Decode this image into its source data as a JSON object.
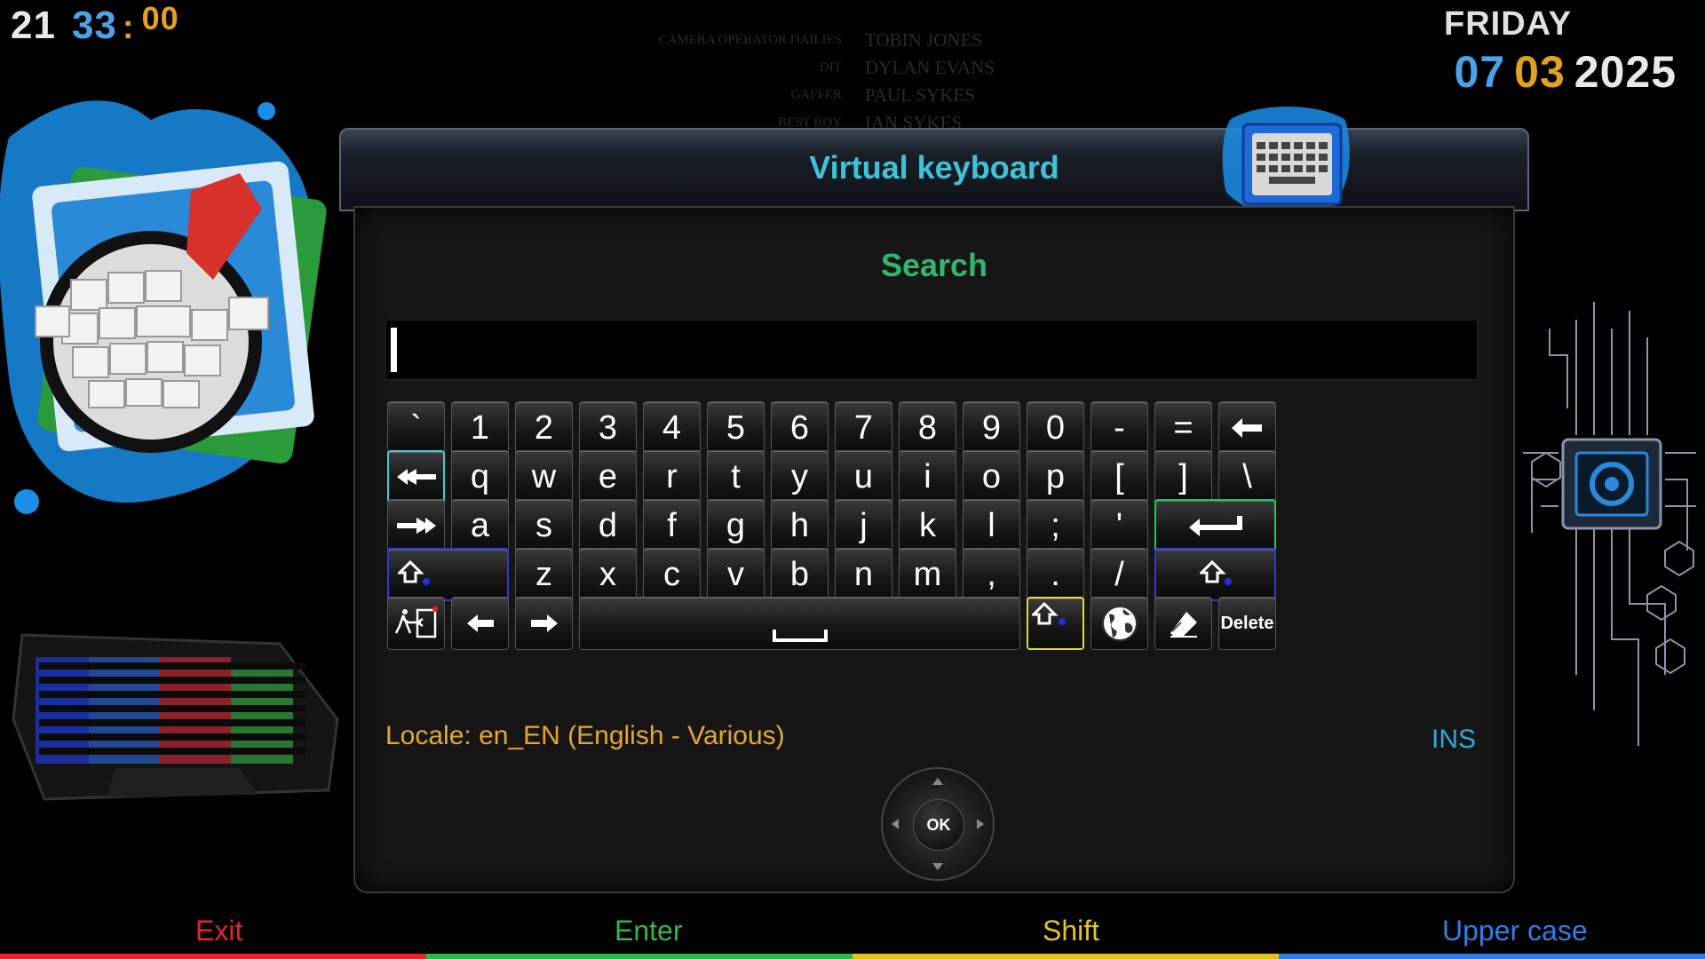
{
  "clock": {
    "hours": "21",
    "minutes": "33",
    "separator": ":",
    "seconds": "00"
  },
  "date": {
    "weekday": "FRIDAY",
    "day": "07",
    "month": "03",
    "year": "2025"
  },
  "credits": [
    {
      "role": "CAMERA OPERATOR DAILIES",
      "name": "TOBIN JONES"
    },
    {
      "role": "DIT",
      "name": "DYLAN EVANS"
    },
    {
      "role": "GAFFER",
      "name": "PAUL SYKES"
    },
    {
      "role": "BEST BOY",
      "name": "IAN SYKES"
    }
  ],
  "dialog": {
    "title": "Virtual keyboard",
    "prompt": "Search",
    "input_value": ""
  },
  "keys": {
    "row1": [
      "`",
      "1",
      "2",
      "3",
      "4",
      "5",
      "6",
      "7",
      "8",
      "9",
      "0",
      "-",
      "="
    ],
    "row2": [
      "q",
      "w",
      "e",
      "r",
      "t",
      "y",
      "u",
      "i",
      "o",
      "p",
      "[",
      "]",
      "\\"
    ],
    "row3": [
      "a",
      "s",
      "d",
      "f",
      "g",
      "h",
      "j",
      "k",
      "l",
      ";",
      "'"
    ],
    "row4": [
      "z",
      "x",
      "c",
      "v",
      "b",
      "n",
      "m",
      ",",
      ".",
      "/"
    ],
    "delete": "Delete"
  },
  "status": {
    "locale": "Locale: en_EN  (English - Various)",
    "mode": "INS"
  },
  "dpad": {
    "ok_label": "OK"
  },
  "footer": [
    {
      "label": "Exit",
      "color": "#e8232a"
    },
    {
      "label": "Enter",
      "color": "#2fb84a"
    },
    {
      "label": "Shift",
      "color": "#e6c420"
    },
    {
      "label": "Upper case",
      "color": "#2f7fe8"
    }
  ],
  "colors": {
    "title": "#3cc3d8",
    "prompt": "#2fb86b",
    "locale": "#e6a630",
    "ins": "#2fa8d8",
    "accent_blue": "#4aa3e8",
    "accent_orange": "#e6a020"
  }
}
